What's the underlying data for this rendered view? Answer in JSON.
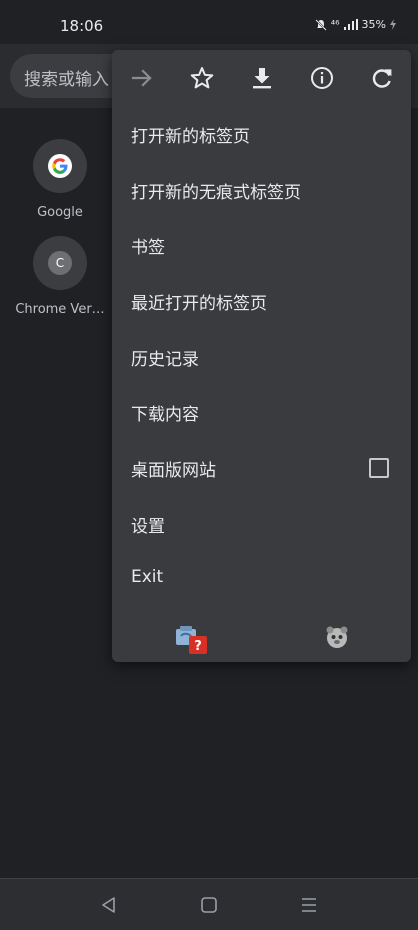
{
  "status_bar": {
    "time": "18:06",
    "network": "⁴⁶",
    "battery": "35%"
  },
  "omnibox": {
    "placeholder": "搜索或输入"
  },
  "tiles": [
    {
      "label": "Google",
      "icon": "google-g-icon"
    },
    {
      "label": "Chrome Ver…",
      "icon_letter": "C"
    }
  ],
  "menu": {
    "top_icons": [
      "forward-arrow-icon",
      "star-icon",
      "download-icon",
      "info-icon",
      "refresh-icon"
    ],
    "items": [
      {
        "label": "打开新的标签页"
      },
      {
        "label": "打开新的无痕式标签页"
      },
      {
        "label": "书签"
      },
      {
        "label": "最近打开的标签页"
      },
      {
        "label": "历史记录"
      },
      {
        "label": "下载内容"
      },
      {
        "label": "桌面版网站",
        "checked": false
      },
      {
        "label": "设置"
      },
      {
        "label": "Exit"
      }
    ],
    "bottom_icons": [
      "extension-help-icon",
      "extension-animal-icon"
    ],
    "help_badge": "?"
  },
  "colors": {
    "background": "#202124",
    "menu_background": "#3a3b3f",
    "text": "#e8eaed",
    "badge_red": "#d93025"
  }
}
